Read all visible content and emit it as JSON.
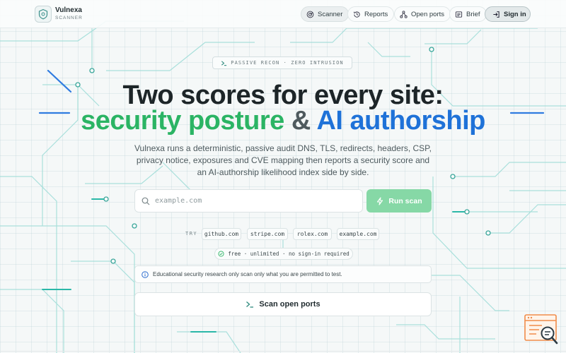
{
  "brand": {
    "name": "Vulnexa",
    "subtitle": "SCANNER"
  },
  "nav": {
    "items": [
      {
        "label": "Scanner",
        "icon": "radar-icon",
        "active": true
      },
      {
        "label": "Reports",
        "icon": "history-icon",
        "active": false
      },
      {
        "label": "Open ports",
        "icon": "network-icon",
        "active": false
      },
      {
        "label": "Brief",
        "icon": "newspaper-icon",
        "active": false
      }
    ],
    "signin_label": "Sign in"
  },
  "hero": {
    "badge": "PASSIVE RECON · ZERO INTRUSION",
    "title_line1": "Two scores for every site:",
    "title_green": "security posture",
    "title_amp": "&",
    "title_blue": "AI authorship",
    "description": "Vulnexa runs a deterministic, passive audit DNS, TLS, redirects, headers, CSP, privacy notice, exposures and CVE mapping then reports a security score and an AI-authorship likelihood index side by side."
  },
  "search": {
    "placeholder": "example.com",
    "value": "",
    "run_label": "Run scan"
  },
  "try": {
    "label": "TRY",
    "examples": [
      "github.com",
      "stripe.com",
      "rolex.com",
      "example.com"
    ]
  },
  "free_note": "free · unlimited · no sign-in required",
  "notice": "Educational security research only scan only what you are permitted to test.",
  "ports_button_label": "Scan open ports",
  "colors": {
    "accent_green": "#2bb464",
    "accent_blue": "#1f72d8",
    "run_button": "#86d8a6",
    "help_fab_orange": "#f08c4a"
  }
}
